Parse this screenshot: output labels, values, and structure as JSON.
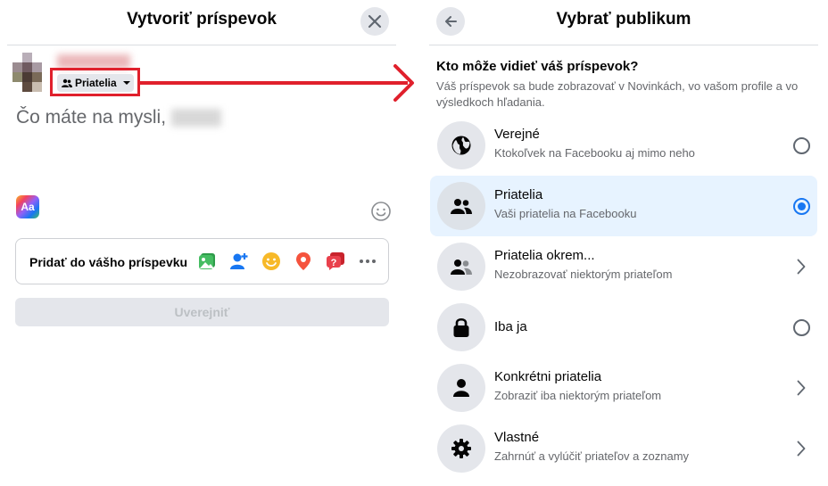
{
  "left": {
    "title": "Vytvoriť príspevok",
    "audience_button_label": "Priatelia",
    "prompt": "Čo máte na mysli,",
    "add_to_post_label": "Pridať do vášho príspevku",
    "publish_label": "Uverejniť",
    "aa_label": "Aa",
    "add_icons": [
      "photo-video-icon",
      "tag-people-icon",
      "feeling-icon",
      "check-in-icon",
      "ask-question-icon",
      "more-icon"
    ]
  },
  "right": {
    "title": "Vybrať publikum",
    "question": "Kto môže vidieť váš príspevok?",
    "description": "Váš príspevok sa bude zobrazovať v Novinkách, vo vašom profile a vo výsledkoch hľadania.",
    "options": [
      {
        "title": "Verejné",
        "subtitle": "Ktokoľvek na Facebooku aj mimo neho",
        "icon": "globe-icon",
        "control": "radio",
        "selected": false
      },
      {
        "title": "Priatelia",
        "subtitle": "Vaši priatelia na Facebooku",
        "icon": "friends-icon",
        "control": "radio",
        "selected": true
      },
      {
        "title": "Priatelia okrem...",
        "subtitle": "Nezobrazovať niektorým priateľom",
        "icon": "friends-except-icon",
        "control": "chevron",
        "selected": false
      },
      {
        "title": "Iba ja",
        "subtitle": "",
        "icon": "lock-icon",
        "control": "radio",
        "selected": false
      },
      {
        "title": "Konkrétni priatelia",
        "subtitle": "Zobraziť iba niektorým priateľom",
        "icon": "person-icon",
        "control": "chevron",
        "selected": false
      },
      {
        "title": "Vlastné",
        "subtitle": "Zahrnúť a vylúčiť priateľov a zoznamy",
        "icon": "gear-icon",
        "control": "chevron",
        "selected": false
      }
    ]
  },
  "colors": {
    "accent": "#1877f2",
    "highlight": "#e0202c",
    "selected_bg": "#e7f3ff"
  }
}
